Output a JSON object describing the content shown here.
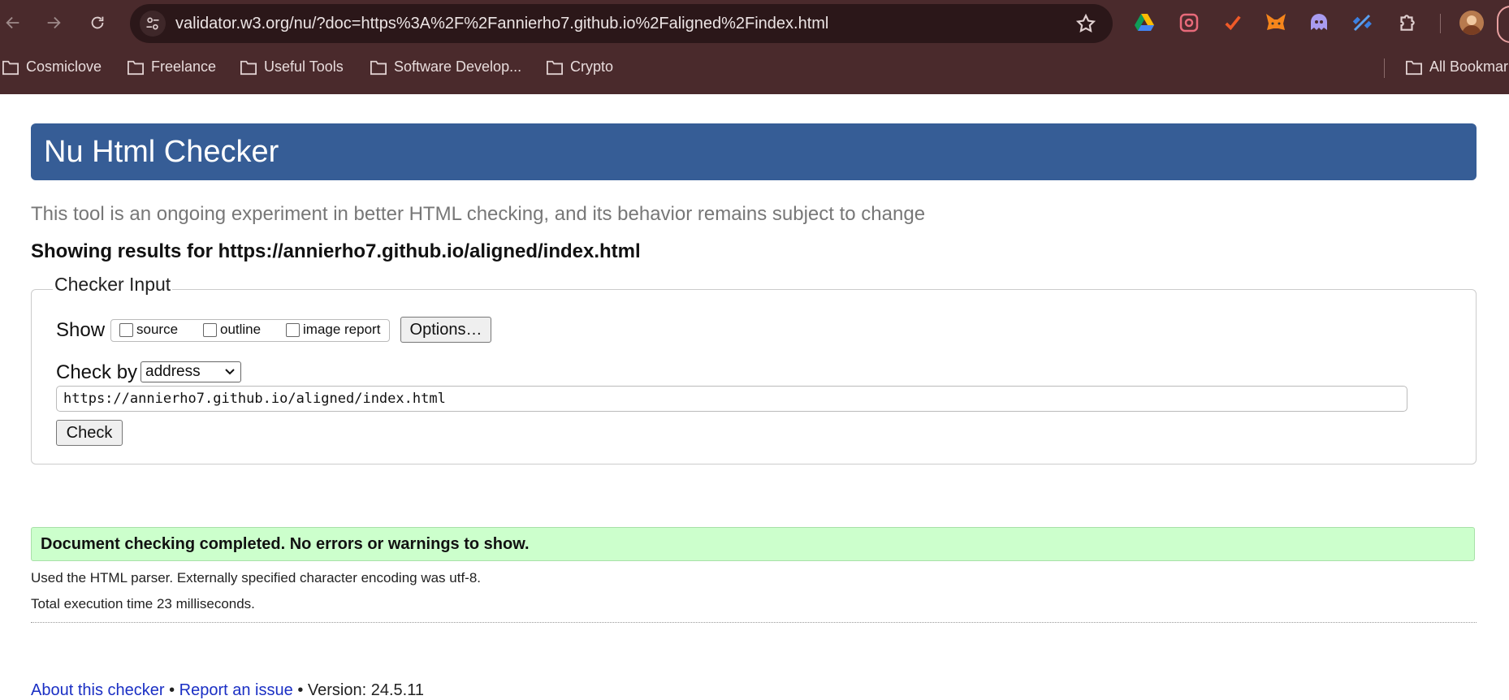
{
  "browser": {
    "url": "validator.w3.org/nu/?doc=https%3A%2F%2Fannierho7.github.io%2Faligned%2Findex.html",
    "bookmarks": [
      "Cosmiclove",
      "Freelance",
      "Useful Tools",
      "Software Develop...",
      "Crypto"
    ],
    "all_bookmarks": "All Bookmarks",
    "extension_icons": [
      "google-drive-icon",
      "lens-icon",
      "tick-icon",
      "metamask-fox-icon",
      "ghost-icon",
      "satellite-icon",
      "puzzle-extensions-icon",
      "profile-avatar"
    ],
    "colors": {
      "frame": "#4a2a2c",
      "omnibox": "#2b1719"
    }
  },
  "page": {
    "title": "Nu Html Checker",
    "tagline": "This tool is an ongoing experiment in better HTML checking, and its behavior remains subject to change",
    "showing": "Showing results for https://annierho7.github.io/aligned/index.html",
    "checker_input": {
      "legend": "Checker Input",
      "show_label": "Show",
      "checkboxes": [
        {
          "label": "source",
          "checked": false
        },
        {
          "label": "outline",
          "checked": false
        },
        {
          "label": "image report",
          "checked": false
        }
      ],
      "options_button": "Options…",
      "check_by_label": "Check by",
      "check_by_value": "address",
      "url_value": "https://annierho7.github.io/aligned/index.html",
      "check_button": "Check"
    },
    "result": {
      "message": "Document checking completed. No errors or warnings to show.",
      "parser_info": "Used the HTML parser. Externally specified character encoding was utf-8.",
      "execution_time": "Total execution time 23 milliseconds."
    },
    "footer": {
      "about_link": "About this checker",
      "separator": "•",
      "report_link": "Report an issue",
      "version": "Version: 24.5.11"
    },
    "colors": {
      "header": "#365d96",
      "success_bg": "#ccffcc",
      "link": "#1a2fc4"
    }
  }
}
